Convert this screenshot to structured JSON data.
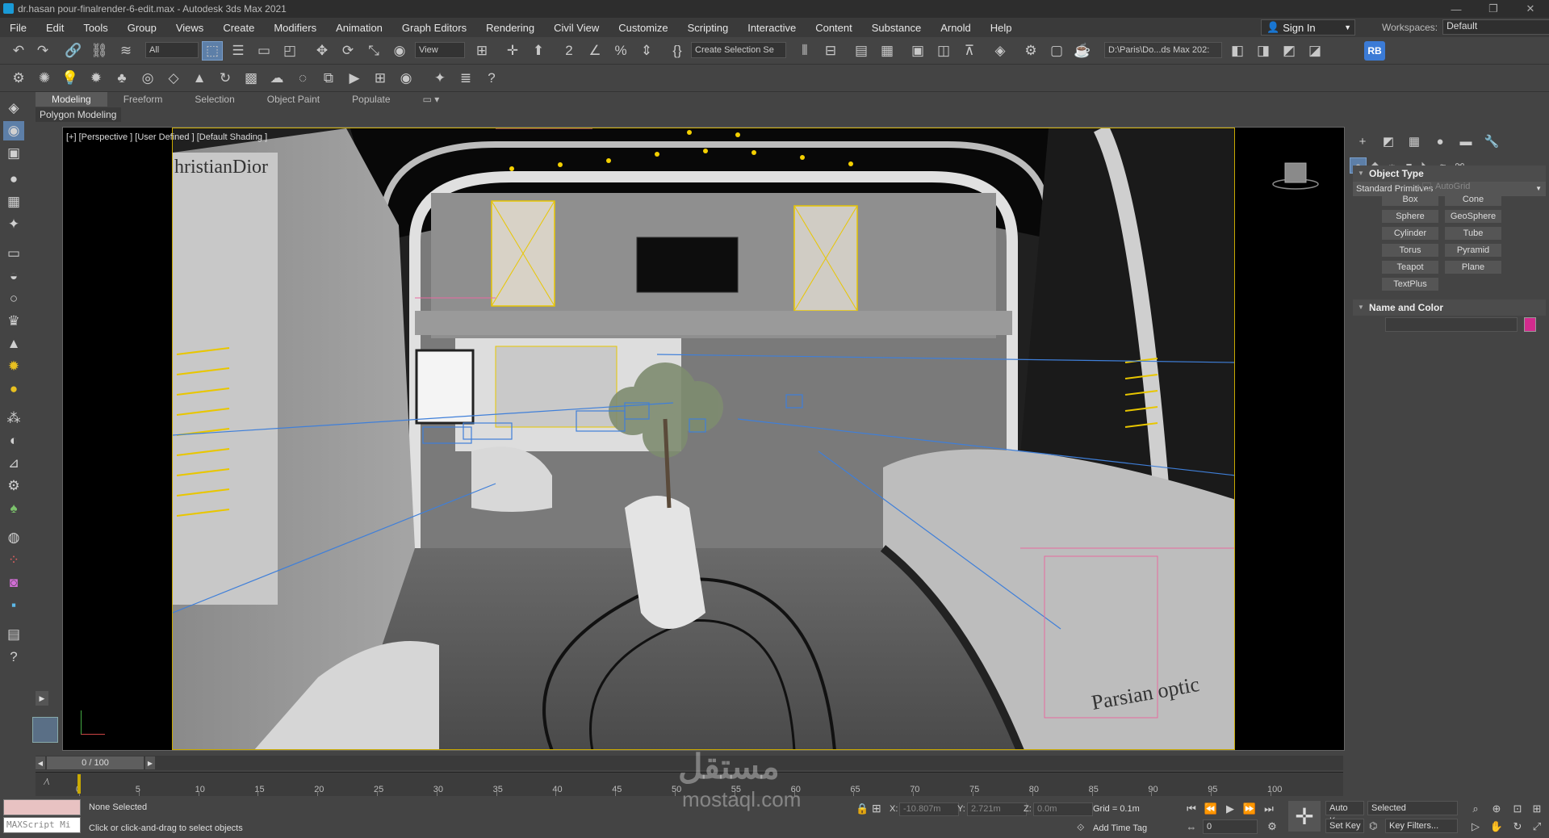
{
  "window": {
    "title": "dr.hasan pour-finalrender-6-edit.max - Autodesk 3ds Max 2021",
    "controls": [
      "—",
      "❐",
      "✕"
    ]
  },
  "menu": [
    "File",
    "Edit",
    "Tools",
    "Group",
    "Views",
    "Create",
    "Modifiers",
    "Animation",
    "Graph Editors",
    "Rendering",
    "Civil View",
    "Customize",
    "Scripting",
    "Interactive",
    "Content",
    "Substance",
    "Arnold",
    "Help"
  ],
  "account": {
    "sign_in": "Sign In",
    "workspaces_label": "Workspaces:",
    "workspace": "Default"
  },
  "toolbar": {
    "selection_filter": "All",
    "ref_coord": "View",
    "named_selection": "Create Selection Se",
    "project_path": "D:\\Paris\\Do...ds Max 202:",
    "rb_badge": "RB"
  },
  "ribbon": {
    "tabs": [
      "Modeling",
      "Freeform",
      "Selection",
      "Object Paint",
      "Populate"
    ],
    "active": "Modeling",
    "panel": "Polygon Modeling"
  },
  "viewport": {
    "label": "[+] [Perspective ] [User Defined ] [Default Shading ]",
    "scene_text": [
      "hristianDior",
      "Parsian optic"
    ]
  },
  "command_panel": {
    "category": "Standard Primitives",
    "object_type_title": "Object Type",
    "autogrid": "AutoGrid",
    "primitives": [
      "Box",
      "Cone",
      "Sphere",
      "GeoSphere",
      "Cylinder",
      "Tube",
      "Torus",
      "Pyramid",
      "Teapot",
      "Plane",
      "TextPlus"
    ],
    "name_color_title": "Name and Color",
    "object_color": "#d22b8d"
  },
  "timeline": {
    "frame_display": "0 / 100",
    "ticks": [
      "0",
      "5",
      "10",
      "15",
      "20",
      "25",
      "30",
      "35",
      "40",
      "45",
      "50",
      "55",
      "60",
      "65",
      "70",
      "75",
      "80",
      "85",
      "90",
      "95",
      "100"
    ]
  },
  "status": {
    "maxscript": "MAXScript Mi",
    "selection": "None Selected",
    "prompt": "Click or click-and-drag to select objects",
    "x_label": "X:",
    "x": "-10.807m",
    "y_label": "Y:",
    "y": "2.721m",
    "z_label": "Z:",
    "z": "0.0m",
    "grid": "Grid = 0.1m",
    "add_time_tag": "Add Time Tag",
    "auto_key": "Auto Key",
    "set_key": "Set Key",
    "selected": "Selected",
    "key_filters": "Key Filters...",
    "frame": "0"
  },
  "watermark": {
    "arabic": "مستقل",
    "latin": "mostaql.com"
  }
}
